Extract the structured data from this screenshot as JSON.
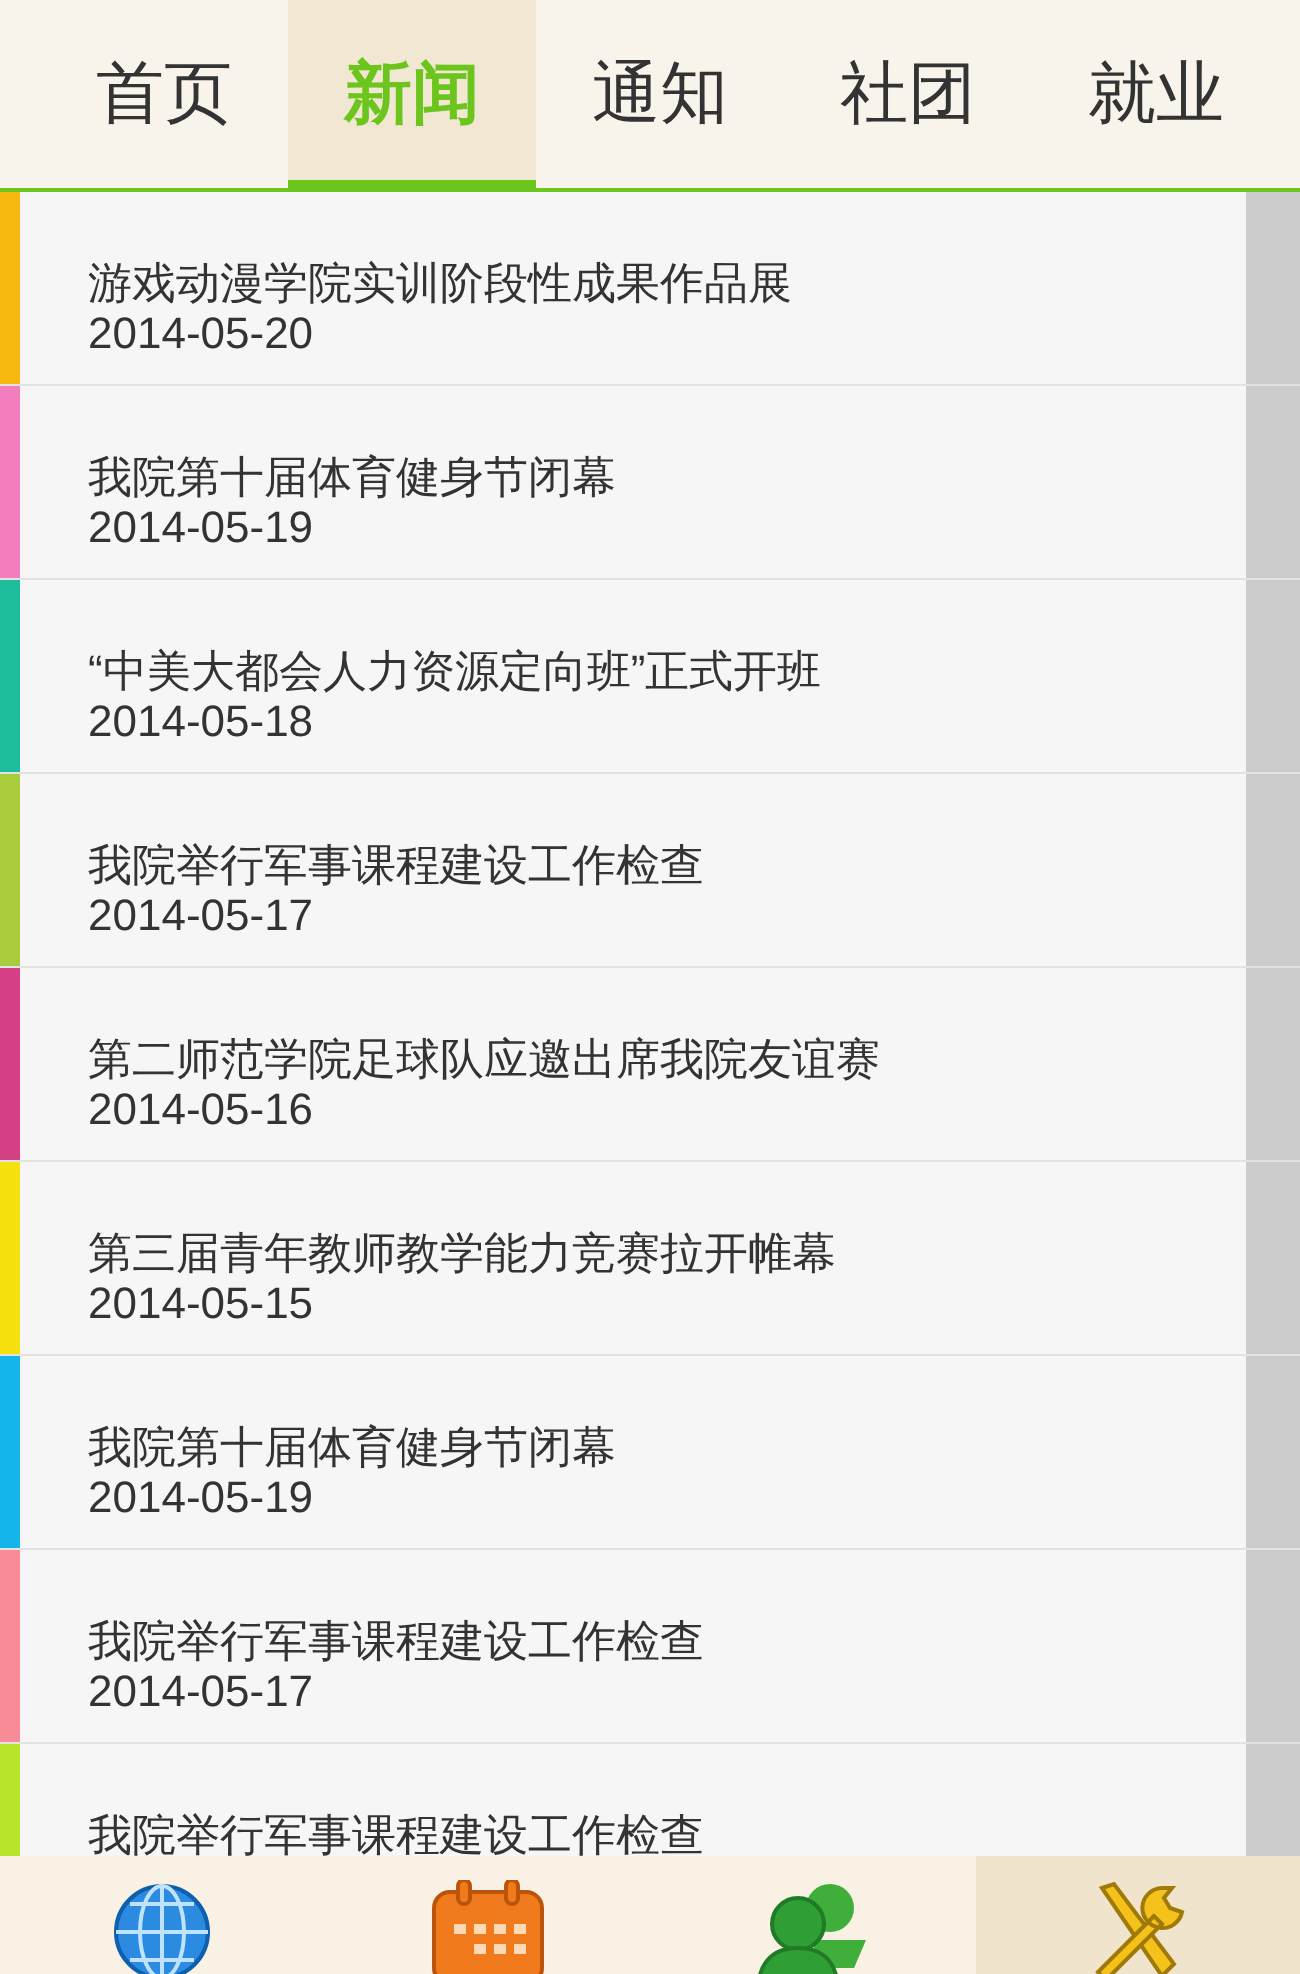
{
  "tabs": [
    {
      "label": "首页",
      "selected": false
    },
    {
      "label": "新闻",
      "selected": true
    },
    {
      "label": "通知",
      "selected": false
    },
    {
      "label": "社团",
      "selected": false
    },
    {
      "label": "就业",
      "selected": false
    }
  ],
  "news": [
    {
      "title": "游戏动漫学院实训阶段性成果作品展",
      "date": "2014-05-20",
      "color": "#f7b90f"
    },
    {
      "title": "我院第十届体育健身节闭幕",
      "date": "2014-05-19",
      "color": "#f27ec0"
    },
    {
      "title": "“中美大都会人力资源定向班”正式开班",
      "date": "2014-05-18",
      "color": "#1dbd9c"
    },
    {
      "title": "我院举行军事课程建设工作检查",
      "date": "2014-05-17",
      "color": "#a8cc3c"
    },
    {
      "title": "第二师范学院足球队应邀出席我院友谊赛",
      "date": "2014-05-16",
      "color": "#d43f86"
    },
    {
      "title": "第三届青年教师教学能力竞赛拉开帷幕",
      "date": "2014-05-15",
      "color": "#f5e10d"
    },
    {
      "title": "我院第十届体育健身节闭幕",
      "date": "2014-05-19",
      "color": "#14b6ea"
    },
    {
      "title": "我院举行军事课程建设工作检查",
      "date": "2014-05-17",
      "color": "#f98b96"
    },
    {
      "title": "我院举行军事课程建设工作检查",
      "color": "#b8e42a"
    }
  ],
  "bottom_nav": [
    {
      "kind": "globe",
      "selected": false
    },
    {
      "kind": "calendar",
      "selected": false
    },
    {
      "kind": "people",
      "selected": false
    },
    {
      "kind": "tools",
      "selected": true
    }
  ]
}
